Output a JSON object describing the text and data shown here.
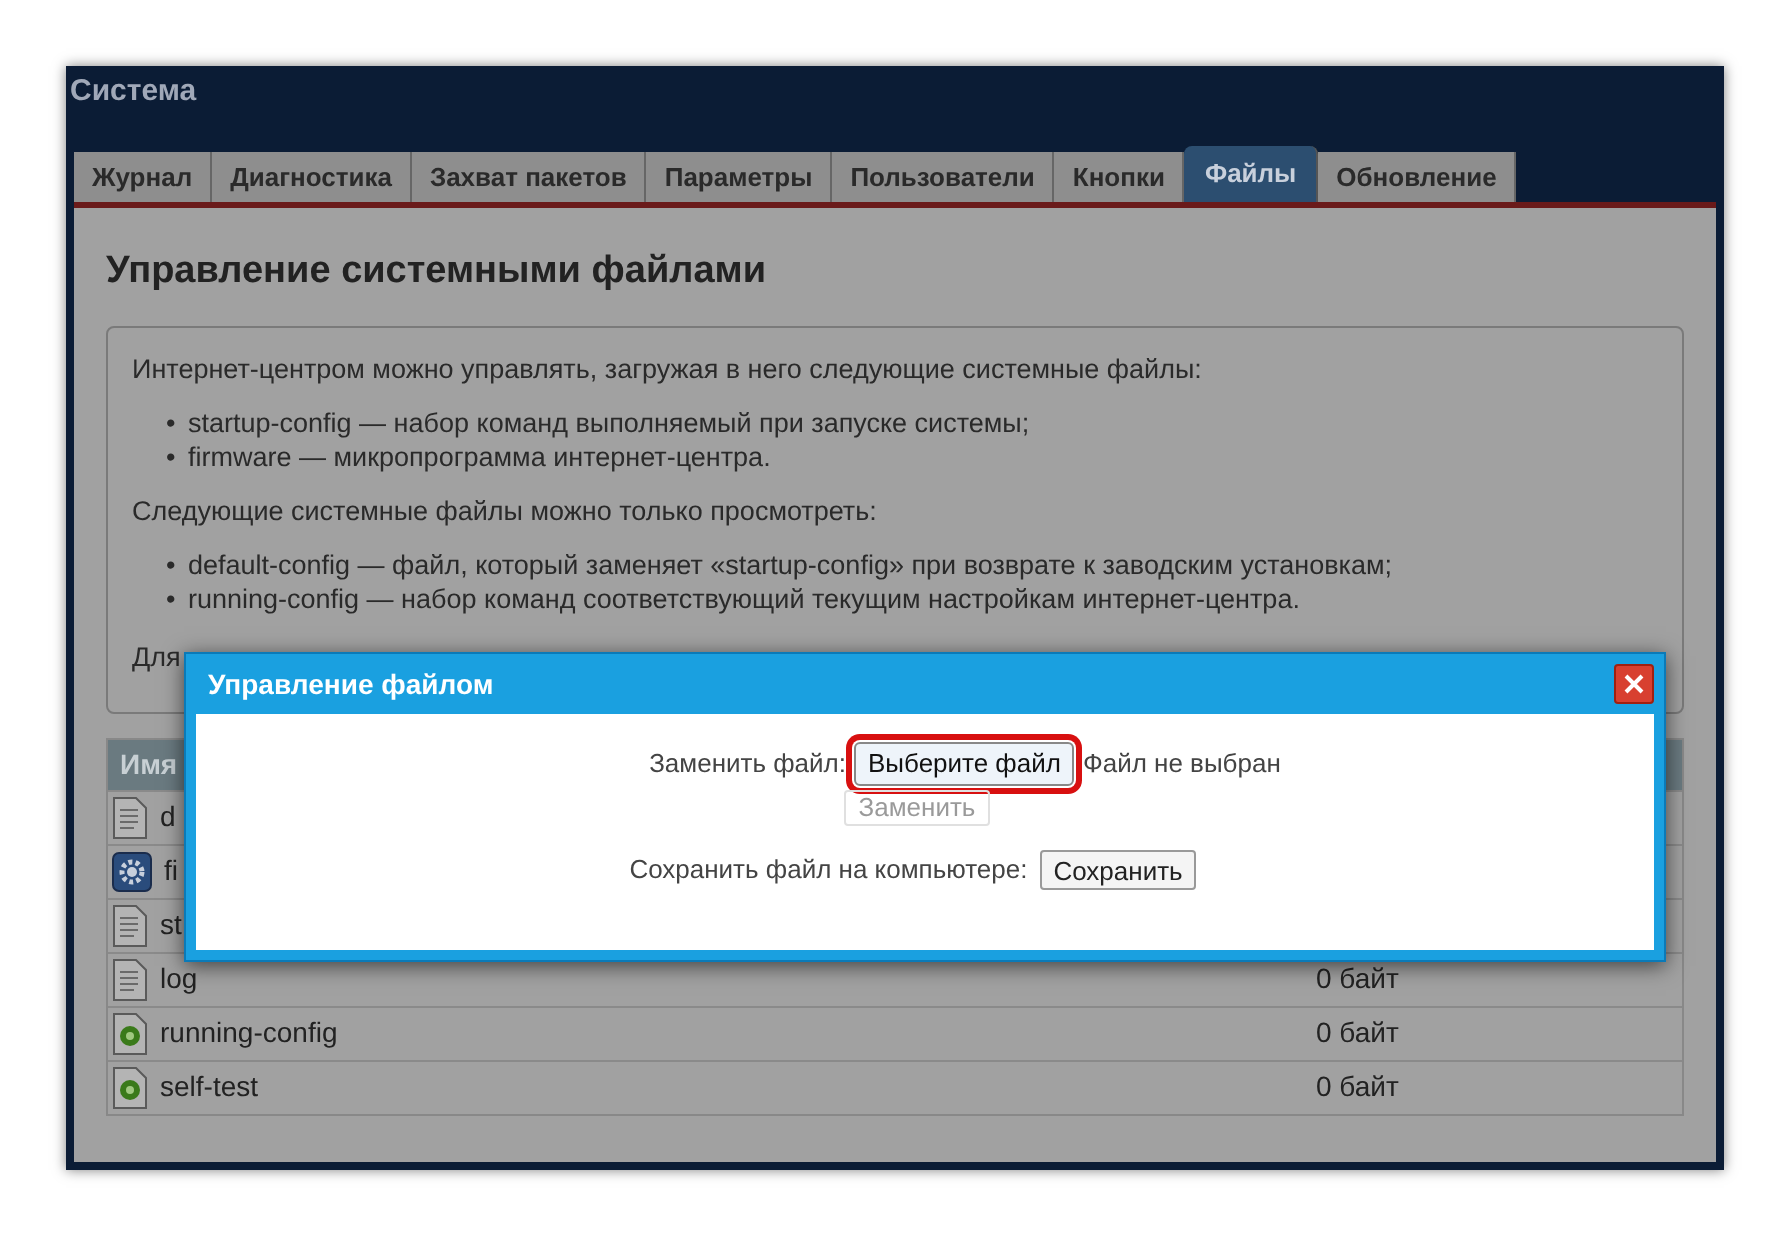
{
  "window": {
    "title": "Система"
  },
  "tabs": [
    {
      "label": "Журнал",
      "selected": false
    },
    {
      "label": "Диагностика",
      "selected": false
    },
    {
      "label": "Захват пакетов",
      "selected": false
    },
    {
      "label": "Параметры",
      "selected": false
    },
    {
      "label": "Пользователи",
      "selected": false
    },
    {
      "label": "Кнопки",
      "selected": false
    },
    {
      "label": "Файлы",
      "selected": true
    },
    {
      "label": "Обновление",
      "selected": false
    }
  ],
  "heading": "Управление системными файлами",
  "info": {
    "intro": "Интернет-центром можно управлять, загружая в него следующие системные файлы:",
    "list_1": [
      {
        "marker": "•",
        "text": "startup-config — набор команд выполняемый при запуске системы;"
      },
      {
        "marker": "•",
        "text": "firmware — микропрограмма интернет-центра."
      }
    ],
    "intro_2": "Следующие системные файлы можно только просмотреть:",
    "list_2": [
      {
        "marker": "•",
        "text": "default-config — файл, который заменяет «startup-config» при возврате к заводским установкам;"
      },
      {
        "marker": "•",
        "text": "running-config — набор команд соответствующий текущим настройкам интернет-центра."
      }
    ],
    "footer": "Для"
  },
  "table": {
    "columns": [
      "Имя"
    ],
    "rows": [
      {
        "kind": "text",
        "name": "d"
      },
      {
        "kind": "firmware",
        "name": "fi"
      },
      {
        "kind": "text",
        "name": "st"
      },
      {
        "kind": "text",
        "name": "log",
        "size": "0 байт"
      },
      {
        "kind": "running",
        "name": "running-config",
        "size": "0 байт"
      },
      {
        "kind": "running",
        "name": "self-test",
        "size": "0 байт"
      }
    ]
  },
  "dialog": {
    "title": "Управление файлом",
    "replace_label": "Заменить файл:",
    "choose_button": {
      "label": "Выберите файл",
      "highlighted": true
    },
    "no_file": "Файл не выбран",
    "replace_button": {
      "label": "Заменить",
      "disabled": true
    },
    "save_label": "Сохранить файл на компьютере:",
    "save_button": {
      "label": "Сохранить"
    }
  }
}
